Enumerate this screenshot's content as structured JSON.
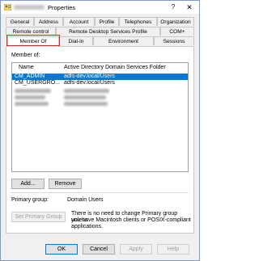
{
  "window": {
    "title": "Properties",
    "help_glyph": "?",
    "close_glyph": "✕"
  },
  "tabs_row1": [
    {
      "label": "General"
    },
    {
      "label": "Address"
    },
    {
      "label": "Account"
    },
    {
      "label": "Profile"
    },
    {
      "label": "Telephones"
    },
    {
      "label": "Organization"
    }
  ],
  "tabs_row2": [
    {
      "label": "Remote control"
    },
    {
      "label": "Remote Desktop Services Profile"
    },
    {
      "label": "COM+"
    }
  ],
  "tabs_row3": [
    {
      "label": "Member Of"
    },
    {
      "label": "Dial-in"
    },
    {
      "label": "Environment"
    },
    {
      "label": "Sessions"
    }
  ],
  "member_of": {
    "label": "Member of:",
    "columns": [
      "Name",
      "Active Directory Domain Services Folder"
    ],
    "rows": [
      {
        "name": "CM_ADMIN",
        "folder": "adfs-dev.local/Users",
        "selected": true
      },
      {
        "name": "CM_USERGRO...",
        "folder": "adfs-dev.local/Users",
        "selected": false
      }
    ],
    "redacted_rows": 3
  },
  "buttons": {
    "add": "Add...",
    "remove": "Remove",
    "set_primary": "Set Primary Group",
    "ok": "OK",
    "cancel": "Cancel",
    "apply": "Apply",
    "help": "Help"
  },
  "primary_group": {
    "label": "Primary group:",
    "value": "Domain Users",
    "note_line1": "There is no need to change Primary group unless",
    "note_line2": "you have Macintosh clients or POSIX-compliant",
    "note_line3": "applications."
  },
  "colors": {
    "selection": "#0078d7",
    "highlight_box": "#e0201b",
    "border": "#7a9cc6"
  }
}
